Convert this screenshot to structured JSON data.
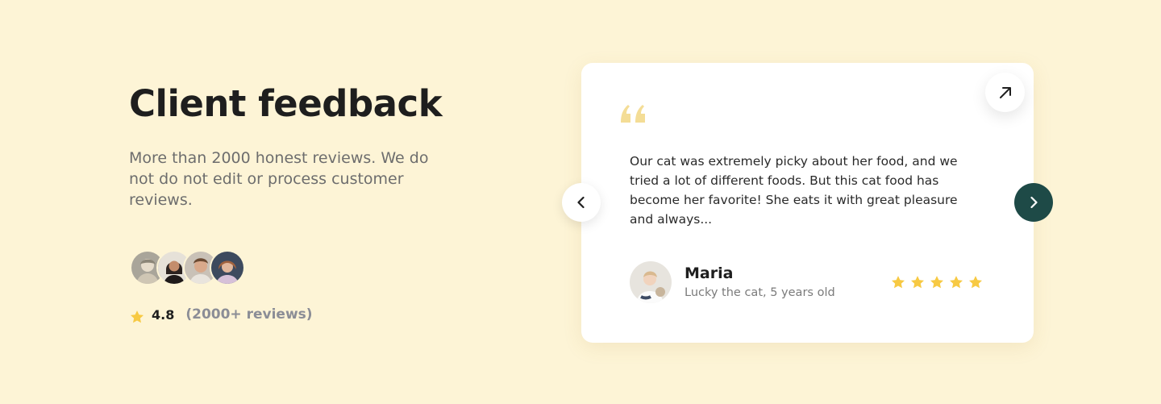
{
  "section": {
    "title": "Client feedback",
    "subtitle": "More than 2000 honest reviews. We do not do not edit or process customer reviews."
  },
  "summary": {
    "avatars": [
      "customer-1",
      "customer-2",
      "customer-3",
      "customer-4"
    ],
    "rating": "4.8",
    "reviews_count": "(2000+ reviews)"
  },
  "review": {
    "text": "Our cat was extremely picky about her food, and we tried a lot of different foods. But this cat food has become her favorite! She eats it with great pleasure and always...",
    "author": "Maria",
    "author_meta": "Lucky the cat, 5 years old",
    "stars": 5
  },
  "icons": {
    "quote": "quote-icon",
    "open": "arrow-up-right-icon",
    "prev": "chevron-left-icon",
    "next": "chevron-right-icon",
    "star": "star-icon"
  },
  "colors": {
    "background": "#fdf4d6",
    "accent_dark": "#1e4a47",
    "star": "#f7c943",
    "quote": "#f4dd96"
  }
}
